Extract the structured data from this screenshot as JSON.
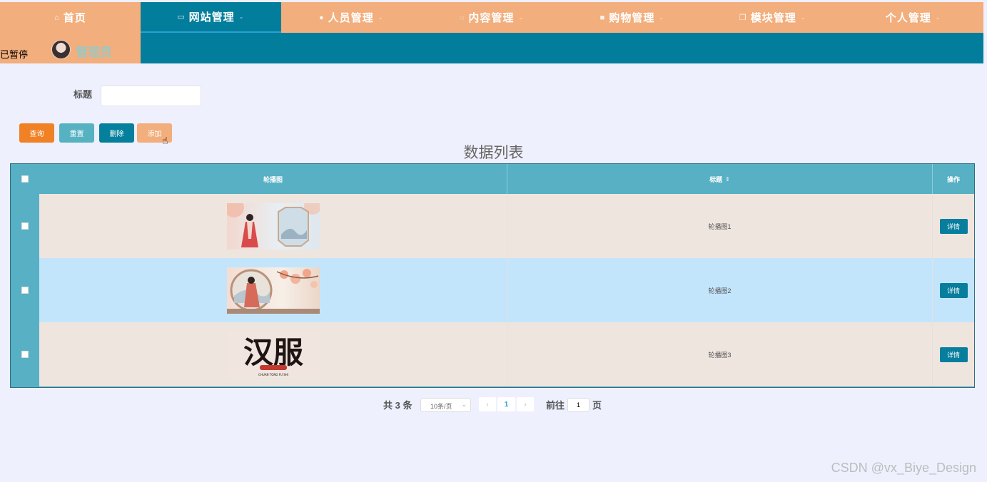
{
  "nav": [
    {
      "icon": "home-icon",
      "glyph": "⌂",
      "label": "首页",
      "caret": false,
      "active": false
    },
    {
      "icon": "monitor-icon",
      "glyph": "▭",
      "label": "网站管理",
      "caret": true,
      "active": true
    },
    {
      "icon": "user-icon",
      "glyph": "●",
      "label": "人员管理",
      "caret": true,
      "active": false
    },
    {
      "icon": "chat-icon",
      "glyph": "◌",
      "label": "内容管理",
      "caret": true,
      "active": false
    },
    {
      "icon": "bag-icon",
      "glyph": "■",
      "label": "购物管理",
      "caret": true,
      "active": false
    },
    {
      "icon": "copy-icon",
      "glyph": "❐",
      "label": "模块管理",
      "caret": true,
      "active": false
    },
    {
      "icon": "",
      "glyph": "",
      "label": "个人管理",
      "caret": true,
      "active": false
    }
  ],
  "overlay_text": "已暂停",
  "user": {
    "name": "管理员"
  },
  "search": {
    "label": "标题",
    "value": ""
  },
  "buttons": {
    "query": "查询",
    "reset": "重置",
    "delete": "删除",
    "add": "添加"
  },
  "list_title": "数据列表",
  "table": {
    "headers": {
      "image": "轮播图",
      "title": "标题",
      "action": "操作"
    },
    "rows": [
      {
        "title": "轮播图1",
        "detail": "详情"
      },
      {
        "title": "轮播图2",
        "detail": "详情"
      },
      {
        "title": "轮播图3",
        "detail": "详情"
      }
    ],
    "row_colors": [
      "#efe5df",
      "#c3e5fb",
      "#efe5df"
    ]
  },
  "pagination": {
    "total_prefix": "共",
    "total": "3",
    "total_suffix": "条",
    "page_size": "10条/页",
    "current": "1",
    "goto_prefix": "前往",
    "goto_value": "1",
    "goto_suffix": "页"
  },
  "thumb3": {
    "big": "汉服",
    "small": "CHUAN TONG FU SHI"
  },
  "watermark": "CSDN @vx_Biye_Design",
  "colors": {
    "accent_orange": "#f2ae7c",
    "teal": "#027d9c",
    "query": "#f08125"
  }
}
